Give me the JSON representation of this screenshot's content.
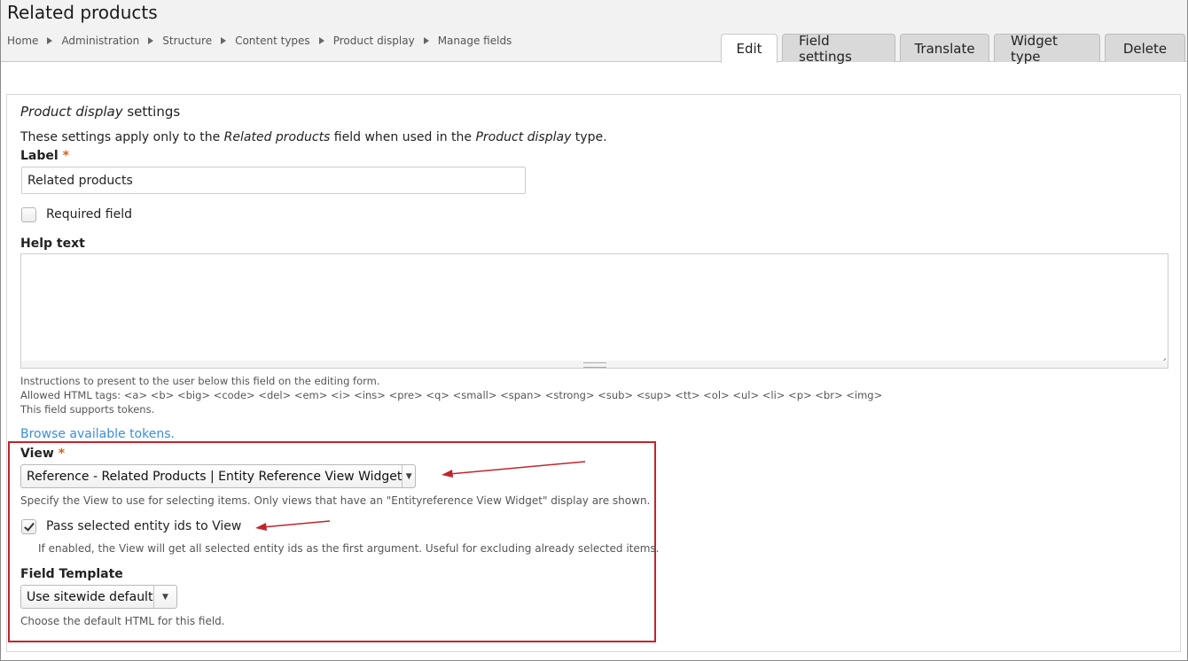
{
  "header": {
    "title": "Related products",
    "breadcrumb": [
      "Home",
      "Administration",
      "Structure",
      "Content types",
      "Product display",
      "Manage fields"
    ],
    "tabs": [
      {
        "label": "Edit",
        "active": true
      },
      {
        "label": "Field settings",
        "active": false
      },
      {
        "label": "Translate",
        "active": false
      },
      {
        "label": "Widget type",
        "active": false
      },
      {
        "label": "Delete",
        "active": false
      }
    ]
  },
  "form": {
    "section_title_em": "Product display",
    "section_title_rest": " settings",
    "desc_prefix": "These settings apply only to the ",
    "desc_field": "Related products",
    "desc_mid": " field when used in the ",
    "desc_type": "Product display",
    "desc_suffix": " type.",
    "label_label": "Label",
    "required_mark": "*",
    "label_value": "Related products",
    "required_field_label": "Required field",
    "required_field_checked": false,
    "help_text_label": "Help text",
    "help_text_value": "",
    "help_desc_1": "Instructions to present to the user below this field on the editing form.",
    "help_desc_2": "Allowed HTML tags: <a> <b> <big> <code> <del> <em> <i> <ins> <pre> <q> <small> <span> <strong> <sub> <sup> <tt> <ol> <ul> <li> <p> <br> <img>",
    "help_desc_3": "This field supports tokens.",
    "browse_tokens_link": "Browse available tokens.",
    "view_label": "View",
    "view_selected": "Reference - Related Products | Entity Reference View Widget",
    "view_desc": "Specify the View to use for selecting items. Only views that have an \"Entityreference View Widget\" display are shown.",
    "pass_ids_label": "Pass selected entity ids to View",
    "pass_ids_checked": true,
    "pass_ids_desc": "If enabled, the View will get all selected entity ids as the first argument. Useful for excluding already selected items.",
    "field_template_label": "Field Template",
    "field_template_selected": "Use sitewide default",
    "field_template_desc": "Choose the default HTML for this field."
  },
  "colors": {
    "highlight_box": "#c0252d",
    "required_mark": "#e05d10",
    "link": "#3b8de0"
  }
}
